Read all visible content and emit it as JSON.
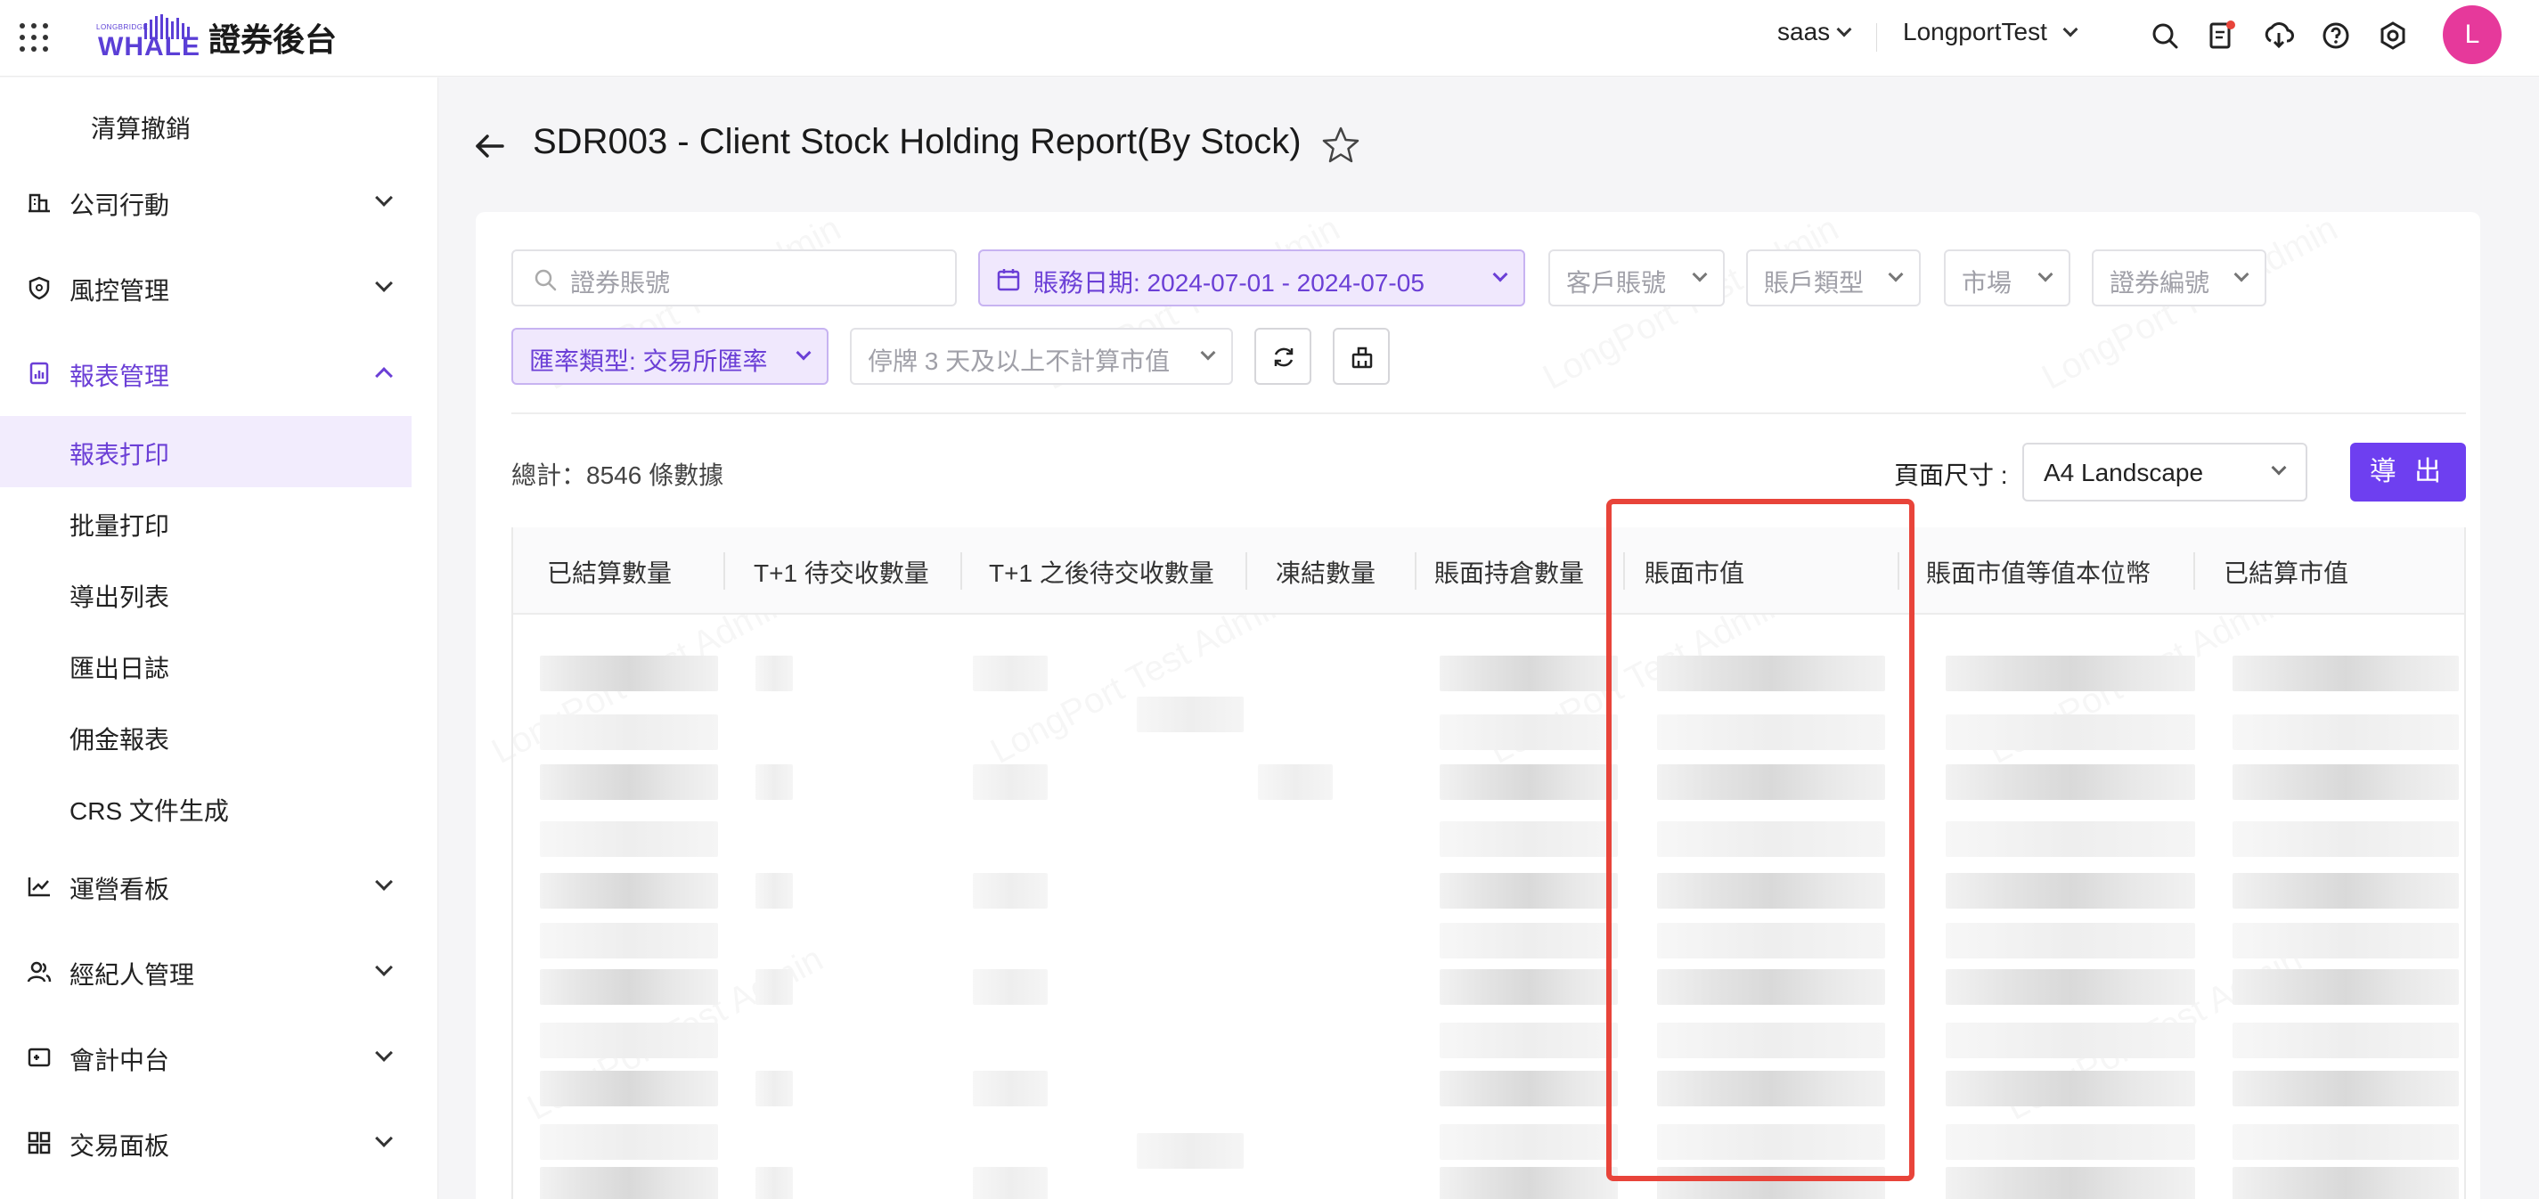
{
  "app": {
    "logo_small": "LONGBRIDGE",
    "logo_main": "WHALE",
    "title": "證券後台"
  },
  "topbar": {
    "tenant": "saas",
    "account": "LongportTest",
    "avatar_letter": "L",
    "icons": [
      "search-icon",
      "document-notification-icon",
      "download-icon",
      "help-icon",
      "settings-icon"
    ],
    "notification_dot_color": "#e8443a"
  },
  "sidebar": {
    "top_sub": "清算撤銷",
    "groups": [
      {
        "label": "公司行動",
        "icon": "building-icon"
      },
      {
        "label": "風控管理",
        "icon": "shield-icon"
      },
      {
        "label": "報表管理",
        "icon": "report-icon",
        "open": true
      },
      {
        "label": "運營看板",
        "icon": "chart-icon"
      },
      {
        "label": "經紀人管理",
        "icon": "users-icon"
      },
      {
        "label": "會計中台",
        "icon": "ledger-icon"
      },
      {
        "label": "交易面板",
        "icon": "dashboard-icon"
      }
    ],
    "report_items": [
      "報表打印",
      "批量打印",
      "導出列表",
      "匯出日誌",
      "佣金報表",
      "CRS 文件生成"
    ],
    "selected_item": "報表打印"
  },
  "page": {
    "title": "SDR003 - Client Stock Holding Report(By Stock)",
    "watermark": "LongPort Test Admin"
  },
  "filters": {
    "search_placeholder": "證券賬號",
    "date_range": "賬務日期: 2024-07-01 - 2024-07-05",
    "client_account": "客戶賬號",
    "account_type": "賬戶類型",
    "market": "市場",
    "security_code": "證券編號",
    "fx_type": "匯率類型: 交易所匯率",
    "suspension": "停牌 3 天及以上不計算市值"
  },
  "toolbar": {
    "total": "總計：8546 條數據",
    "page_size_label": "頁面尺寸 :",
    "page_size_value": "A4 Landscape",
    "export_label": "導 出"
  },
  "table": {
    "columns": [
      "已結算數量",
      "T+1 待交收數量",
      "T+1 之後待交收數量",
      "凍結數量",
      "賬面持倉數量",
      "賬面市值",
      "賬面市值等值本位幣",
      "已結算市值"
    ],
    "highlighted_column": "賬面市值"
  },
  "colors": {
    "accent": "#6e3ff0",
    "accent_light": "#f0e8fd",
    "highlight_border": "#e8443a",
    "avatar": "#e6399b"
  }
}
